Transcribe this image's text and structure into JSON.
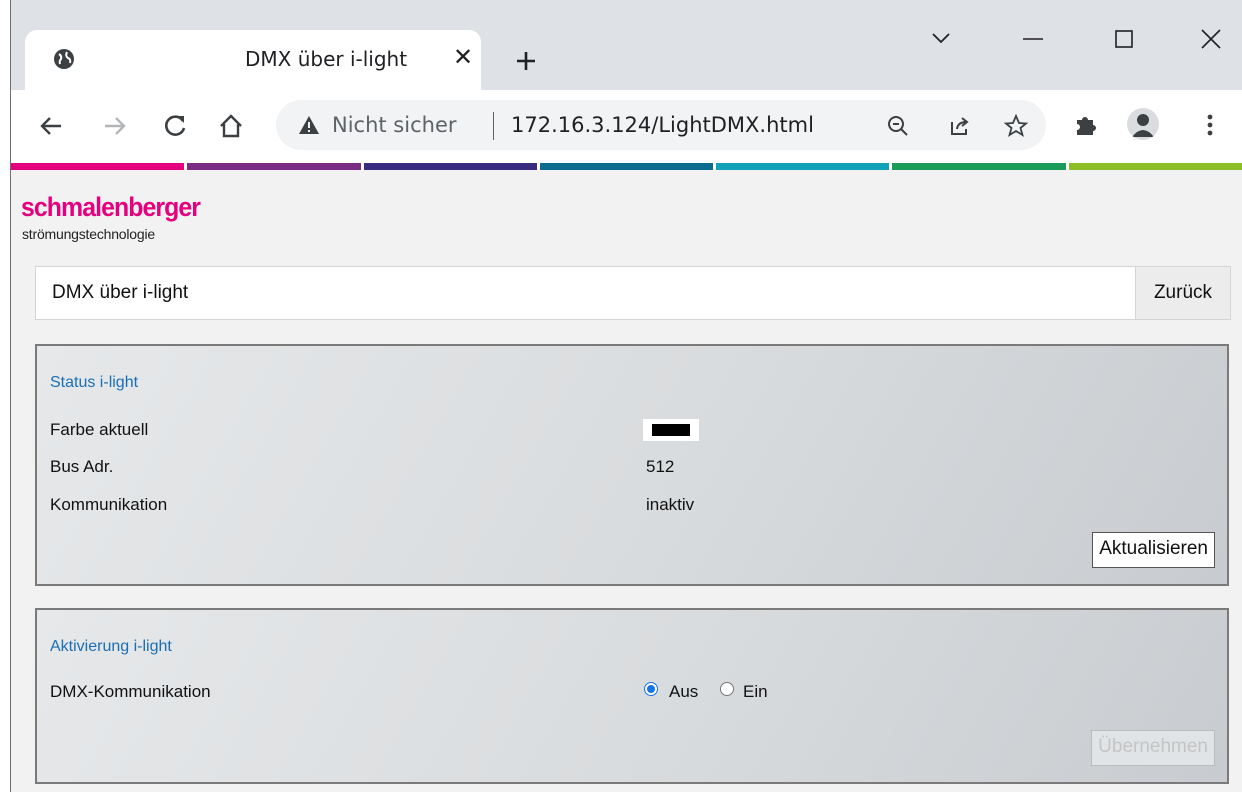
{
  "browser": {
    "tab_title": "DMX über i-light",
    "tab_close": "✕",
    "insecure_label": "Nicht sicher",
    "url": "172.16.3.124/LightDMX.html",
    "colors": {
      "tabstrip": "#dee1e6",
      "omnibox": "#f1f3f4"
    }
  },
  "brand": {
    "name": "schmalenberger",
    "tagline": "strömungstechnologie",
    "color": "#e5007d",
    "stripe_colors": [
      "#e5007d",
      "#7b2c83",
      "#3a2a7f",
      "#0d6b8f",
      "#11a1b8",
      "#1a9b5a",
      "#8cbf26"
    ]
  },
  "header": {
    "title": "DMX über i-light",
    "back_label": "Zurück"
  },
  "status_panel": {
    "title": "Status i-light",
    "rows": [
      {
        "label": "Farbe aktuell",
        "value": ""
      },
      {
        "label": "Bus Adr.",
        "value": "512"
      },
      {
        "label": "Kommunikation",
        "value": "inaktiv"
      }
    ],
    "current_color": "#000000",
    "refresh_label": "Aktualisieren"
  },
  "activation_panel": {
    "title": "Aktivierung i-light",
    "label": "DMX-Kommunikation",
    "options": [
      {
        "label": "Aus",
        "checked": true
      },
      {
        "label": "Ein",
        "checked": false
      }
    ],
    "apply_label": "Übernehmen"
  }
}
